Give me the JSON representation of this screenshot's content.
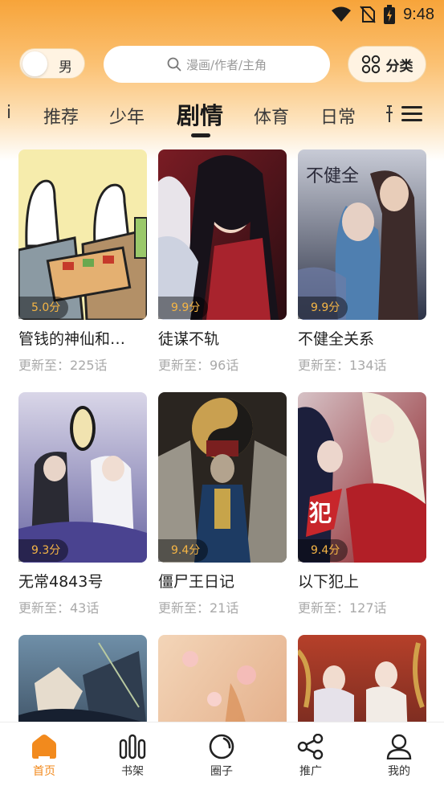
{
  "status_bar": {
    "time": "9:48"
  },
  "top_bar": {
    "gender_label": "男",
    "search_placeholder": "漫画/作者/主角",
    "category_label": "分类"
  },
  "tabs": {
    "partial_left": "i",
    "items": [
      "推荐",
      "少年",
      "剧情",
      "体育",
      "日常"
    ],
    "active": "剧情",
    "partial_right": "the next tab label is cut off"
  },
  "comics": [
    {
      "title": "管钱的神仙和…",
      "score": "5.0分",
      "update": "更新至：225话"
    },
    {
      "title": "徒谋不轨",
      "score": "9.9分",
      "update": "更新至：96话"
    },
    {
      "title": "不健全关系",
      "score": "9.9分",
      "update": "更新至：134话"
    },
    {
      "title": "无常4843号",
      "score": "9.3分",
      "update": "更新至：43话"
    },
    {
      "title": "僵尸王日记",
      "score": "9.4分",
      "update": "更新至：21话"
    },
    {
      "title": "以下犯上",
      "score": "9.4分",
      "update": "更新至：127话"
    },
    {
      "title": "",
      "score": "",
      "update": ""
    },
    {
      "title": "",
      "score": "",
      "update": ""
    },
    {
      "title": "",
      "score": "",
      "update": ""
    }
  ],
  "bottom_nav": {
    "home": "首页",
    "bookshelf": "书架",
    "circle": "圈子",
    "promote": "推广",
    "mine": "我的"
  },
  "colors": {
    "accent": "#f28a1d",
    "score": "#f5b545",
    "header": "#f7a43a"
  }
}
